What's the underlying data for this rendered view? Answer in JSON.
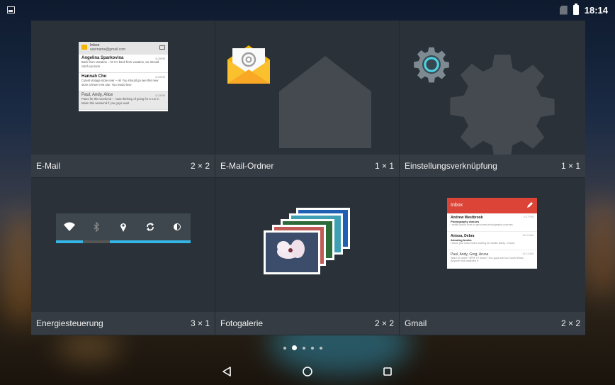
{
  "status_bar": {
    "time": "18:14",
    "icons": [
      "gallery-notification-icon",
      "no-sim-icon",
      "battery-full-icon"
    ]
  },
  "widgets": [
    {
      "name": "E-Mail",
      "size": "2 × 2",
      "preview": "email-widget"
    },
    {
      "name": "E-Mail-Ordner",
      "size": "1 × 1",
      "preview": "email-folder-icon"
    },
    {
      "name": "Einstellungsverknüpfung",
      "size": "1 × 1",
      "preview": "settings-gear-icon"
    },
    {
      "name": "Energiesteuerung",
      "size": "3 × 1",
      "preview": "power-control"
    },
    {
      "name": "Fotogalerie",
      "size": "2 × 2",
      "preview": "photo-gallery-icon"
    },
    {
      "name": "Gmail",
      "size": "2 × 2",
      "preview": "gmail-widget"
    }
  ],
  "email_preview": {
    "folder": "Inbox",
    "account": "username@gmail.com",
    "messages": [
      {
        "from": "Angelina Sparkovina",
        "time": "5:25PM",
        "snippet": "Back from Vacation – hi! I'm back from vacation, we should catch up soon"
      },
      {
        "from": "Hannah Cho",
        "time": "5:23PM",
        "snippet": "Cutest vintage store ever – Hi! You should go see this new store a fewer rest use. You would love"
      },
      {
        "from": "Paul, Andy, Alice",
        "time": "5:23PM",
        "snippet": "Plans for this weekend – I was thinking of going for a run in Marin this weekend if you guys want"
      }
    ]
  },
  "gmail_preview": {
    "folder": "Inbox",
    "messages": [
      {
        "from": "Andrew Westbrook",
        "time": "2:17 PM",
        "subject": "Photography classes",
        "snippet": "I really would love to get some photography courses"
      },
      {
        "from": "Anissa, Debra",
        "time": "11:19 AM",
        "subject": "Amazing books",
        "snippet": "I know you have been looking for books lately. I found"
      },
      {
        "from": "Paul, Andy, Greg, Aruna",
        "time": "11:13 AM",
        "subject": "",
        "snippet": "Want to come? 8PM TV show? You guys are too much fellow. Anyone else watched it"
      }
    ]
  },
  "pagination": {
    "count": 5,
    "active_index": 1
  },
  "nav": [
    "back-icon",
    "home-icon",
    "recents-icon"
  ],
  "colors": {
    "accent": "#33b5e5",
    "gmail_red": "#db4437",
    "envelope": "#f4b400"
  }
}
